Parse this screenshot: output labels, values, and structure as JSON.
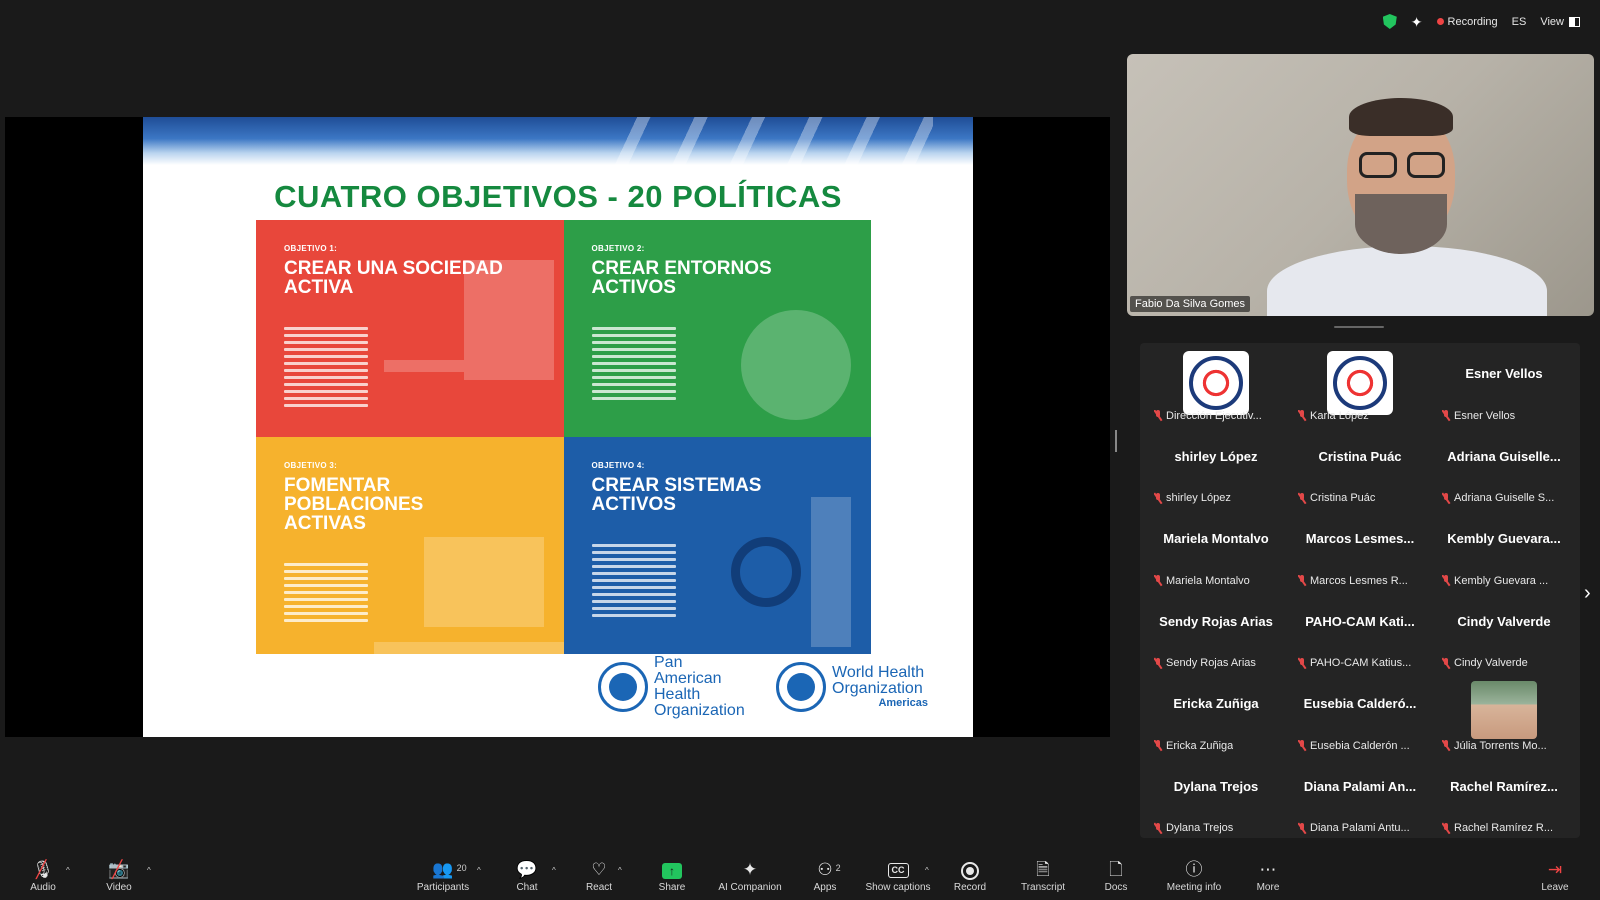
{
  "top_bar": {
    "recording_label": "Recording",
    "language": "ES",
    "view_label": "View"
  },
  "slide": {
    "title": "CUATRO OBJETIVOS - 20 POLÍTICAS",
    "quadrants": [
      {
        "label": "OBJETIVO 1:",
        "heading": "CREAR UNA SOCIEDAD ACTIVA",
        "color": "#e8473b"
      },
      {
        "label": "OBJETIVO 2:",
        "heading": "CREAR ENTORNOS ACTIVOS",
        "color": "#2d9e48"
      },
      {
        "label": "OBJETIVO 3:",
        "heading": "FOMENTAR POBLACIONES ACTIVAS",
        "color": "#f6b22d"
      },
      {
        "label": "OBJETIVO 4:",
        "heading": "CREAR SISTEMAS ACTIVOS",
        "color": "#1d5da8"
      }
    ],
    "logos": {
      "paho": "Pan American Health Organization",
      "who": "World Health Organization",
      "who_sub": "Americas"
    }
  },
  "speaker": {
    "name": "Fabio Da Silva Gomes"
  },
  "gallery": {
    "tiles": [
      {
        "display": "",
        "label": "Dirección Ejecutiv...",
        "avatar": "logo"
      },
      {
        "display": "",
        "label": "Karla López",
        "avatar": "logo"
      },
      {
        "display": "Esner Vellos",
        "label": "Esner Vellos",
        "avatar": "none"
      },
      {
        "display": "shirley López",
        "label": "shirley López",
        "avatar": "none"
      },
      {
        "display": "Cristina Puác",
        "label": "Cristina Puác",
        "avatar": "none"
      },
      {
        "display": "Adriana Guiselle...",
        "label": "Adriana Guiselle S...",
        "avatar": "none"
      },
      {
        "display": "Mariela Montalvo",
        "label": "Mariela Montalvo",
        "avatar": "none"
      },
      {
        "display": "Marcos Lesmes...",
        "label": "Marcos Lesmes R...",
        "avatar": "none"
      },
      {
        "display": "Kembly Guevara...",
        "label": "Kembly Guevara ...",
        "avatar": "none"
      },
      {
        "display": "Sendy Rojas Arias",
        "label": "Sendy Rojas Arias",
        "avatar": "none"
      },
      {
        "display": "PAHO-CAM Kati...",
        "label": "PAHO-CAM Katius...",
        "avatar": "none"
      },
      {
        "display": "Cindy Valverde",
        "label": "Cindy Valverde",
        "avatar": "none"
      },
      {
        "display": "Ericka Zuñiga",
        "label": "Ericka Zuñiga",
        "avatar": "none"
      },
      {
        "display": "Eusebia Calderó...",
        "label": "Eusebia Calderón ...",
        "avatar": "none"
      },
      {
        "display": "",
        "label": "Júlia Torrents Mo...",
        "avatar": "photo"
      },
      {
        "display": "Dylana Trejos",
        "label": "Dylana Trejos",
        "avatar": "none"
      },
      {
        "display": "Diana Palami An...",
        "label": "Diana Palami Antu...",
        "avatar": "none"
      },
      {
        "display": "Rachel Ramírez...",
        "label": "Rachel Ramírez R...",
        "avatar": "none"
      }
    ]
  },
  "toolbar": {
    "audio": "Audio",
    "video": "Video",
    "participants": "Participants",
    "participants_count": "20",
    "chat": "Chat",
    "react": "React",
    "share": "Share",
    "ai_companion": "AI Companion",
    "apps": "Apps",
    "apps_count": "2",
    "captions": "Show captions",
    "record": "Record",
    "transcript": "Transcript",
    "docs": "Docs",
    "meeting_info": "Meeting info",
    "more": "More",
    "leave": "Leave"
  }
}
